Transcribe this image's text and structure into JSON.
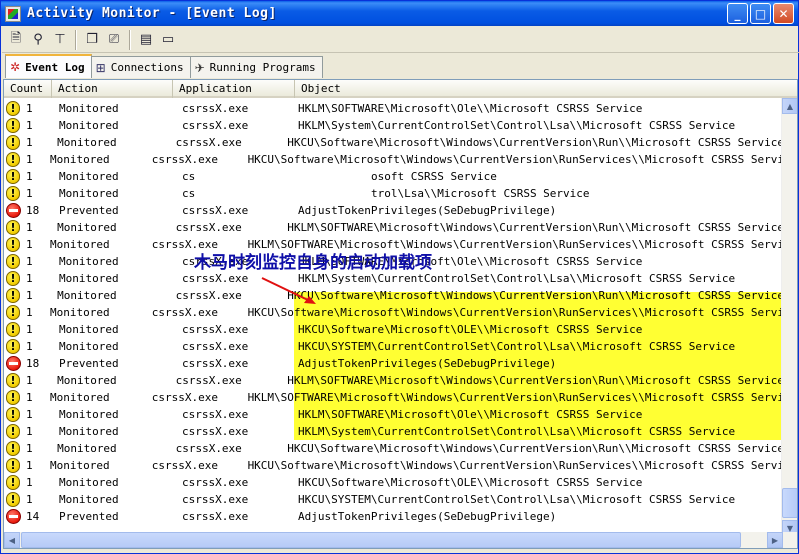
{
  "window": {
    "title": "Activity Monitor - [Event Log]",
    "buttons": {
      "minimize": "_",
      "maximize": "□",
      "close": "✕"
    }
  },
  "toolbar": {
    "icons": [
      "properties-icon",
      "find-icon",
      "tree-icon",
      "copy-icon",
      "clear-icon",
      "cascade-icon",
      "tile-icon"
    ]
  },
  "tabs": [
    {
      "label": "Event Log",
      "icon": "event-log-icon",
      "active": true
    },
    {
      "label": "Connections",
      "icon": "connections-icon",
      "active": false
    },
    {
      "label": "Running Programs",
      "icon": "running-programs-icon",
      "active": false
    }
  ],
  "columns": [
    "Count",
    "Action",
    "Application",
    "Object"
  ],
  "annotation": "木马时刻监控自身的启动加载项",
  "rows": [
    {
      "icon": "warning",
      "count": "1",
      "action": "Monitored",
      "app": "csrssX.exe",
      "object": "HKLM\\SOFTWARE\\Microsoft\\Ole\\\\Microsoft CSRSS Service",
      "hl": false
    },
    {
      "icon": "warning",
      "count": "1",
      "action": "Monitored",
      "app": "csrssX.exe",
      "object": "HKLM\\System\\CurrentControlSet\\Control\\Lsa\\\\Microsoft CSRSS Service",
      "hl": false
    },
    {
      "icon": "warning",
      "count": "1",
      "action": "Monitored",
      "app": "csrssX.exe",
      "object": "HKCU\\Software\\Microsoft\\Windows\\CurrentVersion\\Run\\\\Microsoft CSRSS Service",
      "hl": false
    },
    {
      "icon": "warning",
      "count": "1",
      "action": "Monitored",
      "app": "csrssX.exe",
      "object": "HKCU\\Software\\Microsoft\\Windows\\CurrentVersion\\RunServices\\\\Microsoft CSRSS Servi",
      "hl": false
    },
    {
      "icon": "warning",
      "count": "1",
      "action": "Monitored",
      "app": "cs",
      "object": "osoft CSRSS Service",
      "hl": false,
      "obscured": true
    },
    {
      "icon": "warning",
      "count": "1",
      "action": "Monitored",
      "app": "cs",
      "object": "trol\\Lsa\\\\Microsoft CSRSS Service",
      "hl": false,
      "obscured": true
    },
    {
      "icon": "stop",
      "count": "18",
      "action": "Prevented",
      "app": "csrssX.exe",
      "object": "AdjustTokenPrivileges(SeDebugPrivilege)",
      "hl": false
    },
    {
      "icon": "warning",
      "count": "1",
      "action": "Monitored",
      "app": "csrssX.exe",
      "object": "HKLM\\SOFTWARE\\Microsoft\\Windows\\CurrentVersion\\Run\\\\Microsoft CSRSS Service",
      "hl": true
    },
    {
      "icon": "warning",
      "count": "1",
      "action": "Monitored",
      "app": "csrssX.exe",
      "object": "HKLM\\SOFTWARE\\Microsoft\\Windows\\CurrentVersion\\RunServices\\\\Microsoft CSRSS Servi",
      "hl": true
    },
    {
      "icon": "warning",
      "count": "1",
      "action": "Monitored",
      "app": "csrssX.exe",
      "object": "HKLM\\SOFTWARE\\Microsoft\\Ole\\\\Microsoft CSRSS Service",
      "hl": true
    },
    {
      "icon": "warning",
      "count": "1",
      "action": "Monitored",
      "app": "csrssX.exe",
      "object": "HKLM\\System\\CurrentControlSet\\Control\\Lsa\\\\Microsoft CSRSS Service",
      "hl": true
    },
    {
      "icon": "warning",
      "count": "1",
      "action": "Monitored",
      "app": "csrssX.exe",
      "object": "HKCU\\Software\\Microsoft\\Windows\\CurrentVersion\\Run\\\\Microsoft CSRSS Service",
      "hl": true
    },
    {
      "icon": "warning",
      "count": "1",
      "action": "Monitored",
      "app": "csrssX.exe",
      "object": "HKCU\\Software\\Microsoft\\Windows\\CurrentVersion\\RunServices\\\\Microsoft CSRSS Servi",
      "hl": true
    },
    {
      "icon": "warning",
      "count": "1",
      "action": "Monitored",
      "app": "csrssX.exe",
      "object": "HKCU\\Software\\Microsoft\\OLE\\\\Microsoft CSRSS Service",
      "hl": true
    },
    {
      "icon": "warning",
      "count": "1",
      "action": "Monitored",
      "app": "csrssX.exe",
      "object": "HKCU\\SYSTEM\\CurrentControlSet\\Control\\Lsa\\\\Microsoft CSRSS Service",
      "hl": true
    },
    {
      "icon": "stop",
      "count": "18",
      "action": "Prevented",
      "app": "csrssX.exe",
      "object": "AdjustTokenPrivileges(SeDebugPrivilege)",
      "hl": false
    },
    {
      "icon": "warning",
      "count": "1",
      "action": "Monitored",
      "app": "csrssX.exe",
      "object": "HKLM\\SOFTWARE\\Microsoft\\Windows\\CurrentVersion\\Run\\\\Microsoft CSRSS Service",
      "hl": false
    },
    {
      "icon": "warning",
      "count": "1",
      "action": "Monitored",
      "app": "csrssX.exe",
      "object": "HKLM\\SOFTWARE\\Microsoft\\Windows\\CurrentVersion\\RunServices\\\\Microsoft CSRSS Servi",
      "hl": false
    },
    {
      "icon": "warning",
      "count": "1",
      "action": "Monitored",
      "app": "csrssX.exe",
      "object": "HKLM\\SOFTWARE\\Microsoft\\Ole\\\\Microsoft CSRSS Service",
      "hl": false
    },
    {
      "icon": "warning",
      "count": "1",
      "action": "Monitored",
      "app": "csrssX.exe",
      "object": "HKLM\\System\\CurrentControlSet\\Control\\Lsa\\\\Microsoft CSRSS Service",
      "hl": false
    },
    {
      "icon": "warning",
      "count": "1",
      "action": "Monitored",
      "app": "csrssX.exe",
      "object": "HKCU\\Software\\Microsoft\\Windows\\CurrentVersion\\Run\\\\Microsoft CSRSS Service",
      "hl": false
    },
    {
      "icon": "warning",
      "count": "1",
      "action": "Monitored",
      "app": "csrssX.exe",
      "object": "HKCU\\Software\\Microsoft\\Windows\\CurrentVersion\\RunServices\\\\Microsoft CSRSS Servi",
      "hl": false
    },
    {
      "icon": "warning",
      "count": "1",
      "action": "Monitored",
      "app": "csrssX.exe",
      "object": "HKCU\\Software\\Microsoft\\OLE\\\\Microsoft CSRSS Service",
      "hl": false
    },
    {
      "icon": "warning",
      "count": "1",
      "action": "Monitored",
      "app": "csrssX.exe",
      "object": "HKCU\\SYSTEM\\CurrentControlSet\\Control\\Lsa\\\\Microsoft CSRSS Service",
      "hl": false
    },
    {
      "icon": "stop",
      "count": "14",
      "action": "Prevented",
      "app": "csrssX.exe",
      "object": "AdjustTokenPrivileges(SeDebugPrivilege)",
      "hl": false
    }
  ]
}
